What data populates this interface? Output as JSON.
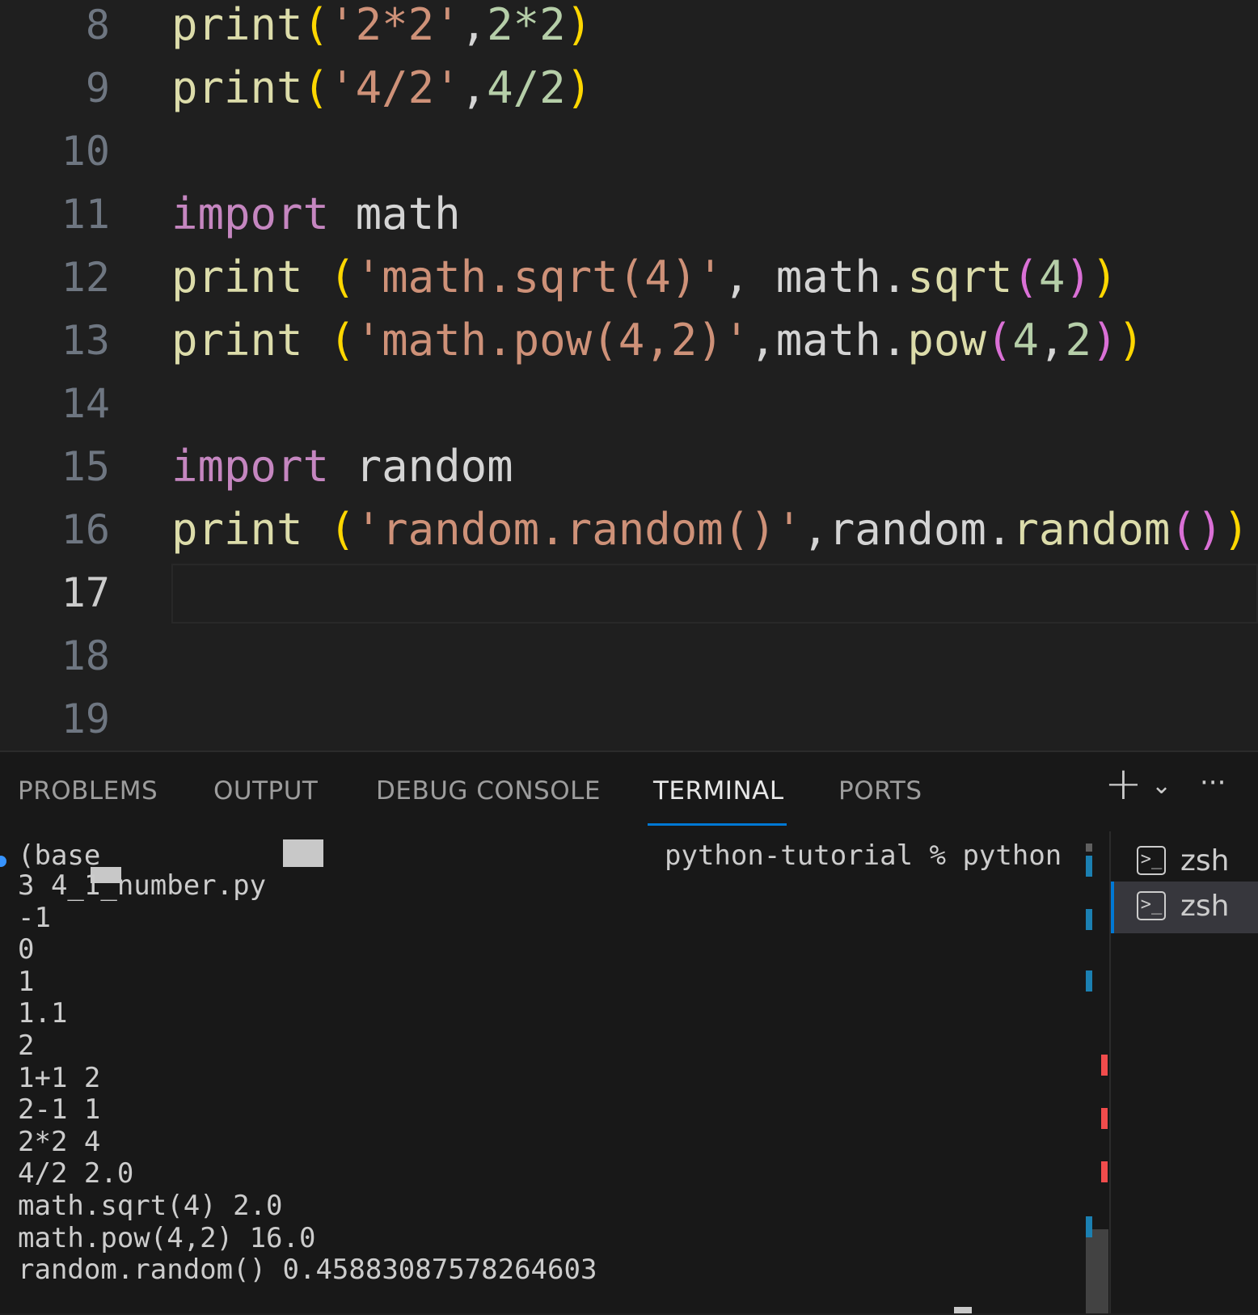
{
  "editor": {
    "lines": [
      {
        "number": "8",
        "tokens": [
          {
            "t": "print",
            "c": "fn"
          },
          {
            "t": "(",
            "c": "p1"
          },
          {
            "t": "'2*2'",
            "c": "str"
          },
          {
            "t": ",",
            "c": "id"
          },
          {
            "t": "2*2",
            "c": "num"
          },
          {
            "t": ")",
            "c": "p1"
          }
        ]
      },
      {
        "number": "9",
        "tokens": [
          {
            "t": "print",
            "c": "fn"
          },
          {
            "t": "(",
            "c": "p1"
          },
          {
            "t": "'4/2'",
            "c": "str"
          },
          {
            "t": ",",
            "c": "id"
          },
          {
            "t": "4/2",
            "c": "num"
          },
          {
            "t": ")",
            "c": "p1"
          }
        ]
      },
      {
        "number": "10",
        "tokens": []
      },
      {
        "number": "11",
        "tokens": [
          {
            "t": "import",
            "c": "kw"
          },
          {
            "t": " math",
            "c": "id"
          }
        ]
      },
      {
        "number": "12",
        "tokens": [
          {
            "t": "print",
            "c": "fn"
          },
          {
            "t": " ",
            "c": "id"
          },
          {
            "t": "(",
            "c": "p1"
          },
          {
            "t": "'math.sqrt(4)'",
            "c": "str"
          },
          {
            "t": ", math.",
            "c": "id"
          },
          {
            "t": "sqrt",
            "c": "fn"
          },
          {
            "t": "(",
            "c": "p2"
          },
          {
            "t": "4",
            "c": "num"
          },
          {
            "t": ")",
            "c": "p2"
          },
          {
            "t": ")",
            "c": "p1"
          }
        ]
      },
      {
        "number": "13",
        "tokens": [
          {
            "t": "print",
            "c": "fn"
          },
          {
            "t": " ",
            "c": "id"
          },
          {
            "t": "(",
            "c": "p1"
          },
          {
            "t": "'math.pow(4,2)'",
            "c": "str"
          },
          {
            "t": ",math.",
            "c": "id"
          },
          {
            "t": "pow",
            "c": "fn"
          },
          {
            "t": "(",
            "c": "p2"
          },
          {
            "t": "4",
            "c": "num"
          },
          {
            "t": ",",
            "c": "id"
          },
          {
            "t": "2",
            "c": "num"
          },
          {
            "t": ")",
            "c": "p2"
          },
          {
            "t": ")",
            "c": "p1"
          }
        ]
      },
      {
        "number": "14",
        "tokens": []
      },
      {
        "number": "15",
        "tokens": [
          {
            "t": "import",
            "c": "kw"
          },
          {
            "t": " random",
            "c": "id"
          }
        ]
      },
      {
        "number": "16",
        "tokens": [
          {
            "t": "print",
            "c": "fn"
          },
          {
            "t": " ",
            "c": "id"
          },
          {
            "t": "(",
            "c": "p1"
          },
          {
            "t": "'random.random()'",
            "c": "str"
          },
          {
            "t": ",random.",
            "c": "id"
          },
          {
            "t": "random",
            "c": "fn"
          },
          {
            "t": "(",
            "c": "p2"
          },
          {
            "t": ")",
            "c": "p2"
          },
          {
            "t": ")",
            "c": "p1"
          }
        ]
      },
      {
        "number": "17",
        "tokens": [],
        "active": true
      },
      {
        "number": "18",
        "tokens": []
      },
      {
        "number": "19",
        "tokens": []
      }
    ]
  },
  "panel": {
    "tabs": [
      {
        "label": "PROBLEMS"
      },
      {
        "label": "OUTPUT"
      },
      {
        "label": "DEBUG CONSOLE"
      },
      {
        "label": "TERMINAL",
        "active": true
      },
      {
        "label": "PORTS"
      }
    ],
    "actions": {
      "new_terminal": "+",
      "dropdown": "⌄",
      "more": "···"
    }
  },
  "terminal": {
    "prompt_prefix": "(base",
    "prompt_suffix": "python-tutorial % python",
    "output": [
      "3 4_1_number.py",
      "-1",
      "0",
      "1",
      "1.1",
      "2",
      "1+1 2",
      "2-1 1",
      "2*2 4",
      "4/2 2.0",
      "math.sqrt(4) 2.0",
      "math.pow(4,2) 16.0",
      "random.random() 0.45883087578264603"
    ],
    "instances": [
      {
        "name": "zsh",
        "icon": ">_"
      },
      {
        "name": "zsh",
        "icon": ">_",
        "active": true
      }
    ]
  },
  "colors": {
    "accent": "#0078d4",
    "keyword": "#c586c0",
    "function": "#dcdcaa",
    "string": "#ce9178",
    "number": "#b5cea8",
    "bracket1": "#ffd700",
    "bracket2": "#da70d6"
  }
}
